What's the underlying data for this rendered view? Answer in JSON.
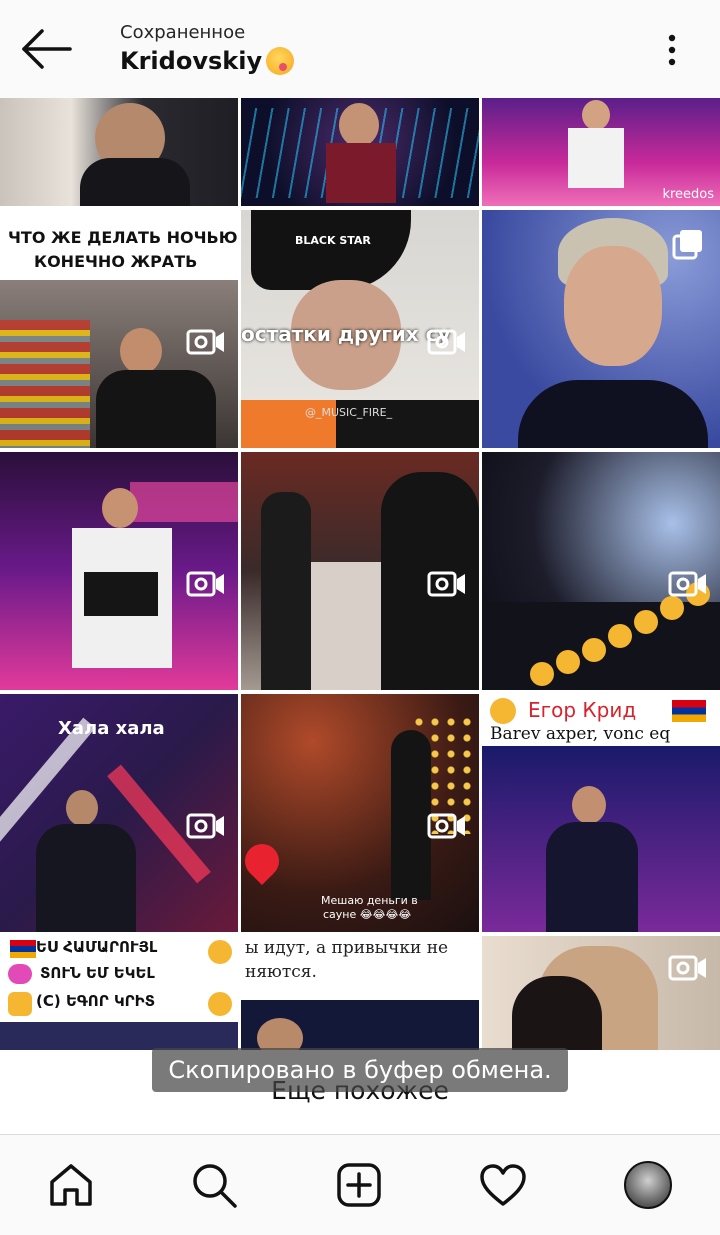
{
  "header": {
    "subtitle": "Сохраненное",
    "title": "Kridovskiy",
    "back_icon": "arrow-left-icon",
    "more_icon": "vertical-dots-icon"
  },
  "tiles": {
    "t1": {
      "kind": "photo"
    },
    "t2": {
      "kind": "photo"
    },
    "t3": {
      "kind": "photo",
      "watermark": "kreedos"
    },
    "t4": {
      "kind": "video",
      "line1": "ЧТО ЖЕ ДЕЛАТЬ НОЧЬЮ",
      "line2": "КОНЕЧНО ЖРАТЬ"
    },
    "t5": {
      "kind": "video",
      "overlay": "остатки других су",
      "hat": "BLACK STAR",
      "tag": "@_MUSIC_FIRE_"
    },
    "t6": {
      "kind": "carousel"
    },
    "t7": {
      "kind": "video"
    },
    "t8": {
      "kind": "video"
    },
    "t9": {
      "kind": "video"
    },
    "t10": {
      "kind": "video",
      "overlay": "Хала хала"
    },
    "t11": {
      "kind": "video",
      "line1": "Мешаю деньги в",
      "line2": "сауне 😂😂😂😂"
    },
    "t12": {
      "kind": "video",
      "line1": "Егор Крид",
      "line2": "Barev axper, vonc eq"
    },
    "t13": {
      "kind": "video",
      "line1": "ԵՍ ՀԱՄԱՐՈՒՅԼ",
      "line2": "ՏՈՒՆ ԵՄ ԵԿԵԼ",
      "line3": "(C) ԵԳՈՐ ԿՐԻՏ"
    },
    "t14": {
      "kind": "photo",
      "line1": "ы идут, а привычки не",
      "line2": "няются."
    },
    "t15": {
      "kind": "video"
    }
  },
  "toast": "Скопировано в буфер обмена.",
  "more_section": "Еще похожее",
  "nav": {
    "items": [
      "home-icon",
      "search-icon",
      "add-post-icon",
      "heart-icon",
      "profile-avatar"
    ]
  }
}
